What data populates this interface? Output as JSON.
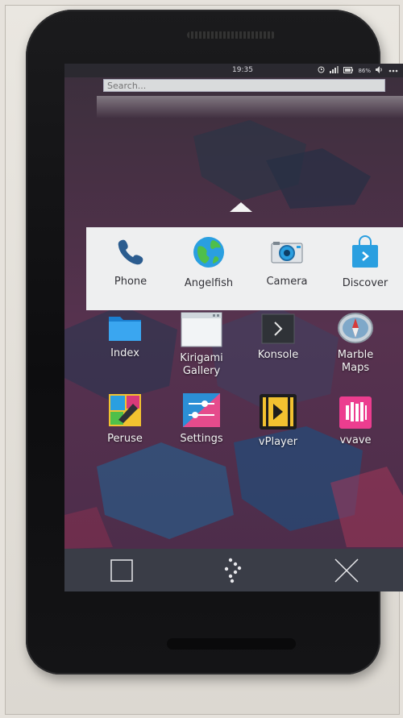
{
  "status_bar": {
    "time": "19:35",
    "battery": "86%"
  },
  "search": {
    "placeholder": "Search..."
  },
  "favorites": [
    {
      "label": "Phone",
      "icon": "phone-icon"
    },
    {
      "label": "Angelfish",
      "icon": "globe-icon"
    },
    {
      "label": "Camera",
      "icon": "camera-icon"
    },
    {
      "label": "Discover",
      "icon": "shopping-bag-icon"
    }
  ],
  "apps": [
    {
      "label_lines": [
        "Index"
      ],
      "icon": "folder-icon"
    },
    {
      "label_lines": [
        "Kirigami",
        "Gallery"
      ],
      "icon": "window-icon"
    },
    {
      "label_lines": [
        "Konsole"
      ],
      "icon": "terminal-icon"
    },
    {
      "label_lines": [
        "Marble",
        "Maps"
      ],
      "icon": "compass-icon"
    },
    {
      "label_lines": [
        "Peruse"
      ],
      "icon": "comic-icon"
    },
    {
      "label_lines": [
        "Settings"
      ],
      "icon": "settings-icon"
    },
    {
      "label_lines": [
        "vPlayer"
      ],
      "icon": "film-play-icon"
    },
    {
      "label_lines": [
        "vvave"
      ],
      "icon": "music-grid-icon"
    }
  ],
  "navbar": {
    "buttons": [
      "overview-square-icon",
      "home-dots-icon",
      "close-x-icon"
    ]
  },
  "colors": {
    "wallpaper_base": "#4a2f48",
    "favorites_bg": "#eeeff0",
    "navbar_bg": "#3a3d47",
    "accent_blue": "#2a9fe0"
  }
}
